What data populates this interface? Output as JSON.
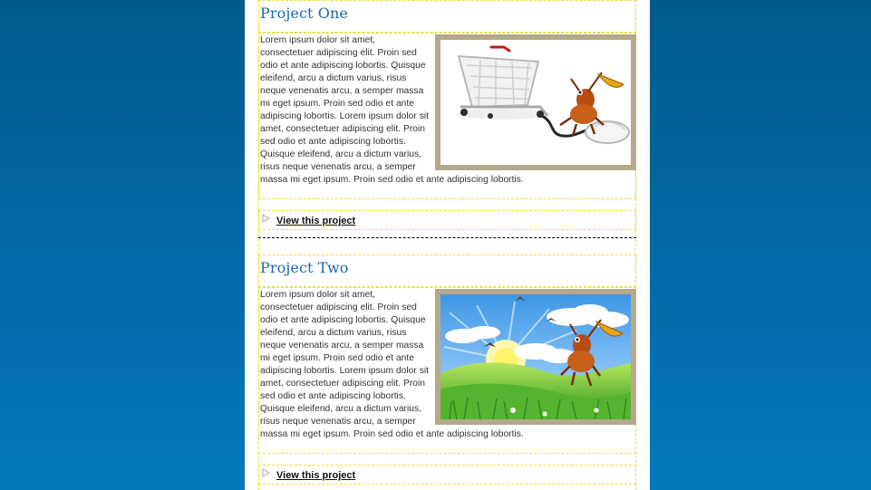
{
  "projects": [
    {
      "title": "Project One",
      "description": "Lorem ipsum dolor sit amet, consectetuer adipiscing elit. Proin sed odio et ante adipiscing lobortis. Quisque eleifend, arcu a dictum varius, risus neque venenatis arcu, a semper massa mi eget ipsum. Proin sed odio et ante adipiscing lobortis. Lorem ipsum dolor sit amet, consectetuer adipiscing elit. Proin sed odio et ante adipiscing lobortis. Quisque eleifend, arcu a dictum varius, risus neque venenatis arcu, a semper massa mi eget ipsum. Proin sed odio et ante adipiscing lobortis.",
      "image": "shopping-cart-mouse-ant-illustration",
      "link_label": "View this project"
    },
    {
      "title": "Project Two",
      "description": "Lorem ipsum dolor sit amet, consectetuer adipiscing elit. Proin sed odio et ante adipiscing lobortis. Quisque eleifend, arcu a dictum varius, risus neque venenatis arcu, a semper massa mi eget ipsum. Proin sed odio et ante adipiscing lobortis. Lorem ipsum dolor sit amet, consectetuer adipiscing elit. Proin sed odio et ante adipiscing lobortis. Quisque eleifend, arcu a dictum varius, risus neque venenatis arcu, a semper massa mi eget ipsum. Proin sed odio et ante adipiscing lobortis.",
      "image": "meadow-sun-ant-illustration",
      "link_label": "View this project"
    }
  ],
  "icons": {
    "bullet": "triangle-bullet-icon"
  },
  "colors": {
    "background_top": "#005a8c",
    "background_bottom": "#0478bd",
    "title": "#1a69a8",
    "guide": "#e9e230",
    "image_frame": "#b4a98a"
  }
}
